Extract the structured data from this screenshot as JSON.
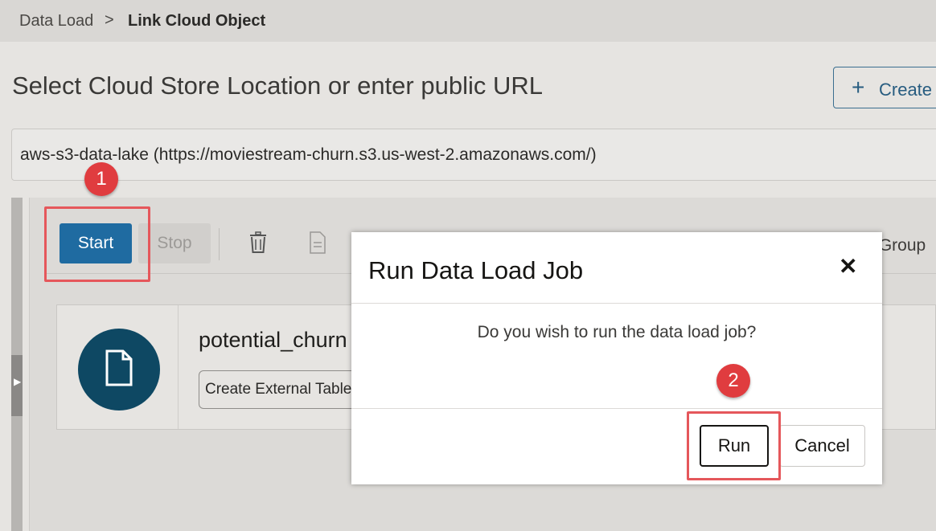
{
  "breadcrumb": {
    "home": "Data Load",
    "separator": ">",
    "current": "Link Cloud Object"
  },
  "page": {
    "title": "Select Cloud Store Location or enter public URL",
    "create_plus": "+",
    "create_label": "Create"
  },
  "location": {
    "value": "aws-s3-data-lake (https://moviestream-churn.s3.us-west-2.amazonaws.com/)"
  },
  "toolbar": {
    "start_label": "Start",
    "stop_label": "Stop",
    "group_label": "r Group"
  },
  "card": {
    "name": "potential_churn",
    "tag": "Create External Table"
  },
  "callouts": {
    "first": "1",
    "second": "2"
  },
  "dialog": {
    "title": "Run Data Load Job",
    "close_glyph": "✕",
    "message": "Do you wish to run the data load job?",
    "run_label": "Run",
    "cancel_label": "Cancel"
  },
  "colors": {
    "accent": "#1f6ba1",
    "callout": "#e03c3f",
    "avatar": "#0e4863"
  }
}
